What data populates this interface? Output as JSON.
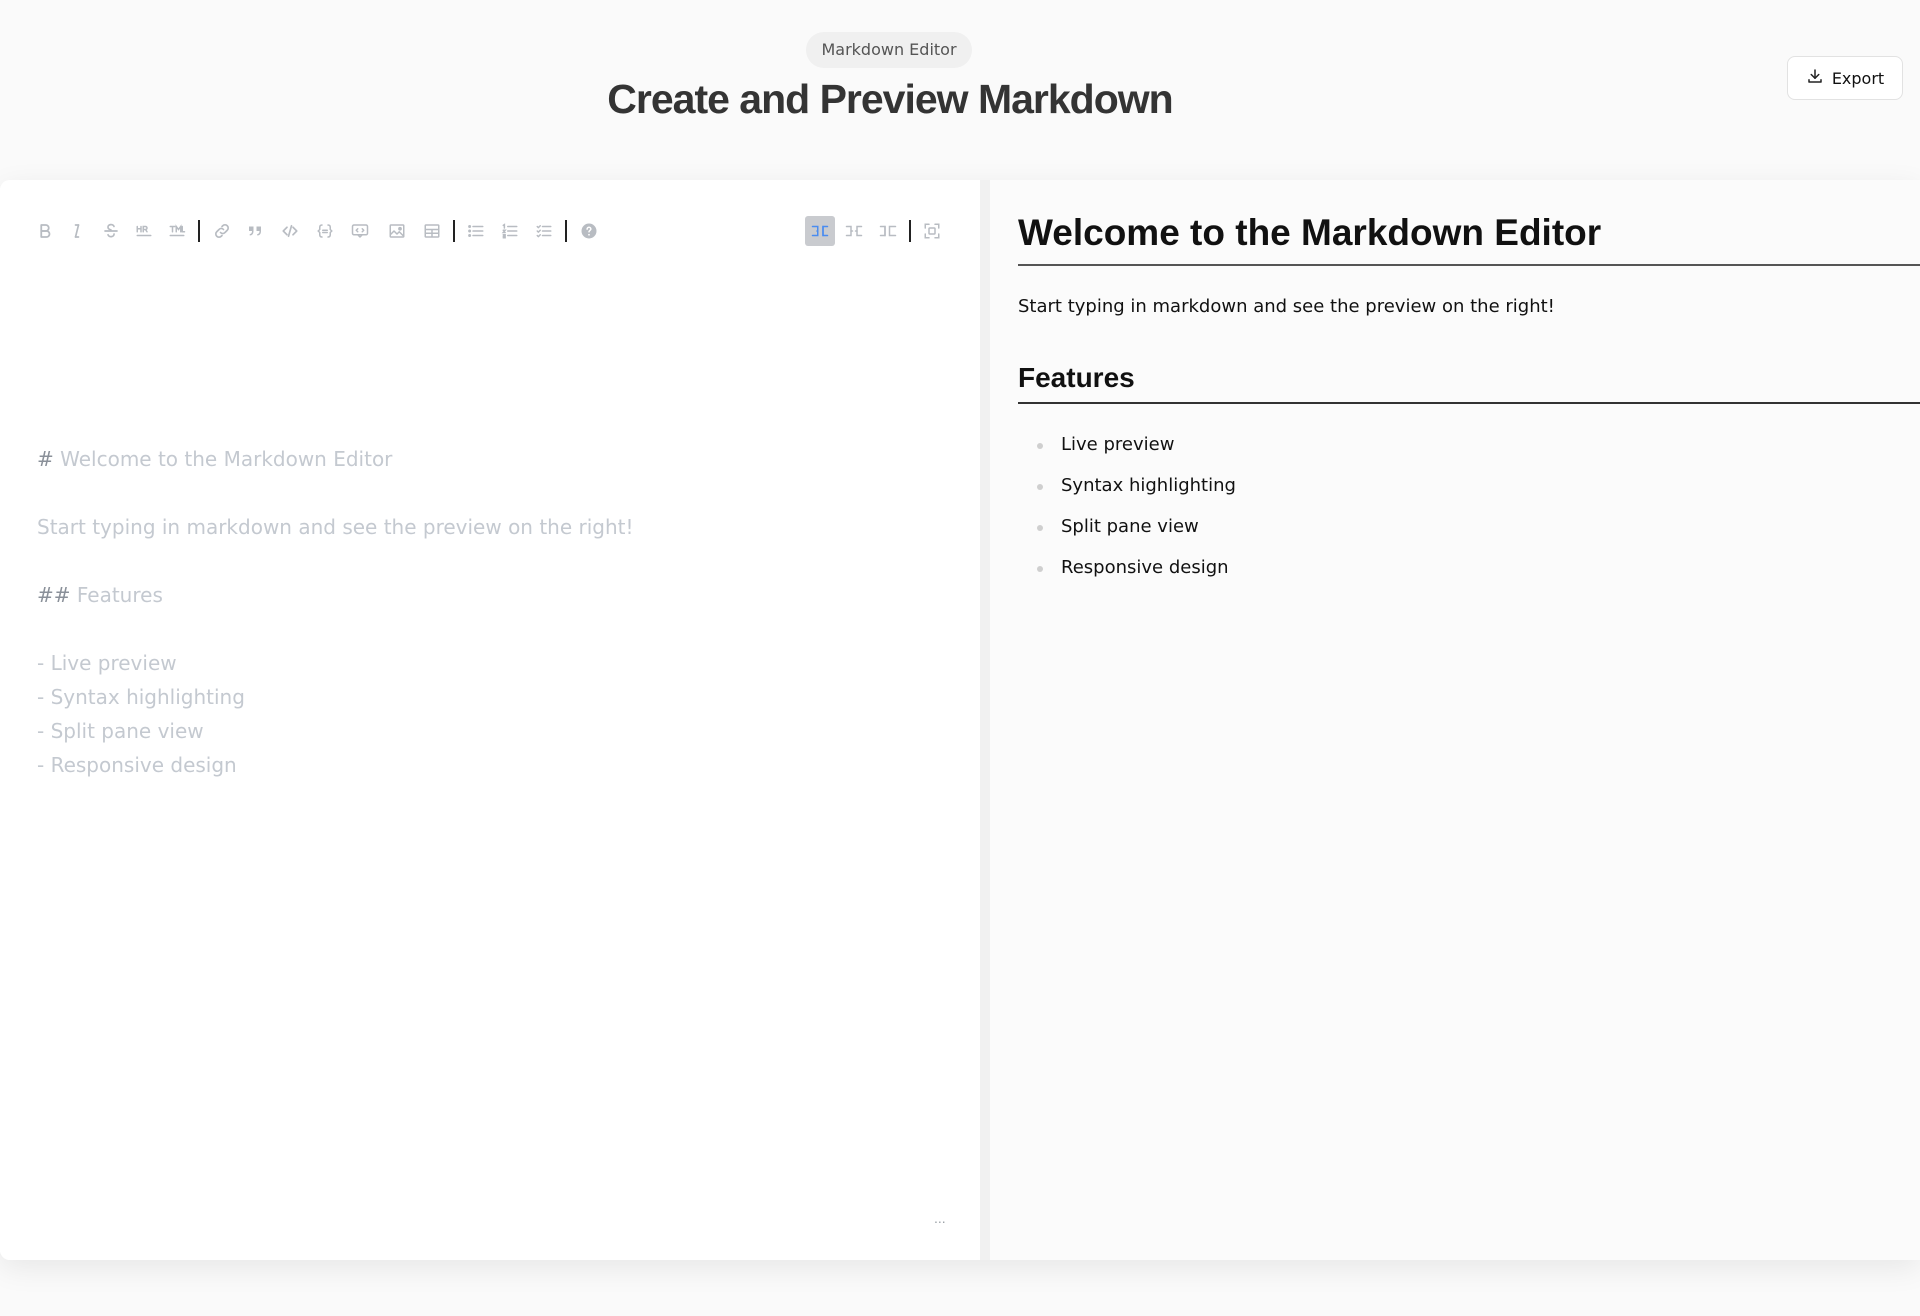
{
  "header": {
    "badge": "Markdown Editor",
    "title": "Create and Preview Markdown",
    "export_label": "Export"
  },
  "toolbar": {
    "icons": [
      "bold-icon",
      "italic-icon",
      "strikethrough-icon",
      "horizontal-rule-icon",
      "title-icon",
      "link-icon",
      "quote-icon",
      "inline-code-icon",
      "code-block-icon",
      "comment-icon",
      "image-icon",
      "table-icon",
      "unordered-list-icon",
      "ordered-list-icon",
      "checklist-icon",
      "help-icon",
      "preview-only-icon",
      "split-view-icon",
      "edit-only-icon",
      "fullscreen-icon"
    ],
    "accent_color": "#4a8cf0"
  },
  "editor": {
    "heading_marker": "#",
    "heading_text": " Welcome to the Markdown Editor",
    "paragraph": "Start typing in markdown and see the preview on the right!",
    "h2_marker": "##",
    "h2_text": " Features",
    "list_items": [
      "- Live preview",
      "- Syntax highlighting",
      "- Split pane view",
      "- Responsive design"
    ],
    "status": "..."
  },
  "preview": {
    "h1": "Welcome to the Markdown Editor",
    "paragraph": "Start typing in markdown and see the preview on the right!",
    "h2": "Features",
    "list_items": [
      "Live preview",
      "Syntax highlighting",
      "Split pane view",
      "Responsive design"
    ]
  }
}
